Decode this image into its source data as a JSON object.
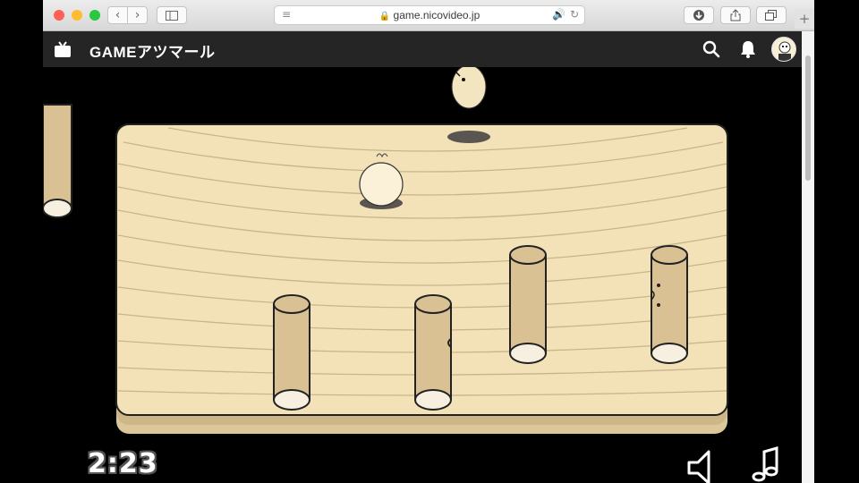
{
  "browser": {
    "url": "game.nicovideo.jp",
    "traffic_light_colors": [
      "#fe5f57",
      "#febc2e",
      "#28c840"
    ]
  },
  "site": {
    "brand": "GAMEアツマール",
    "accent": "#252525"
  },
  "game": {
    "timer": "2:23",
    "board_color": "#f3e2b8",
    "post_color": "#d9c194"
  },
  "icons": [
    "tv-logo-icon",
    "search-icon",
    "bell-icon",
    "avatar",
    "speaker-icon",
    "music-note-icon",
    "download-icon",
    "share-icon",
    "tabs-icon",
    "reader-icon",
    "lock-icon",
    "audio-icon",
    "reload-icon",
    "sidebar-icon",
    "back-icon",
    "forward-icon"
  ]
}
